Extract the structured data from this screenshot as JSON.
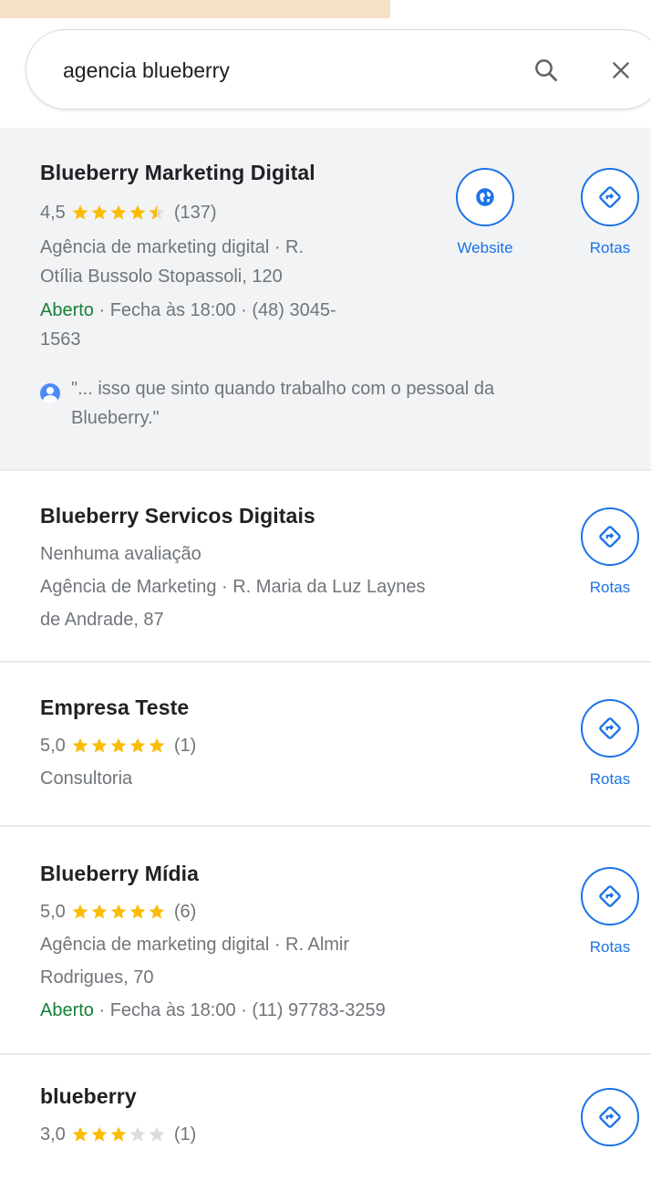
{
  "search": {
    "query": "agencia blueberry",
    "search_icon": "search-icon",
    "clear_icon": "close-icon"
  },
  "colors": {
    "accent": "#1a73e8",
    "star": "#fbbc04",
    "open": "#188038",
    "muted": "#70757a"
  },
  "results": [
    {
      "title": "Blueberry Marketing Digital",
      "rating": "4,5",
      "stars_value": 4.5,
      "reviews": "(137)",
      "category_address_1": "Agência de marketing digital · R.",
      "category_address_2": "Otília Bussolo Stopassoli, 120",
      "open": "Aberto",
      "hours_phone_1": " · Fecha às 18:00 · (48) 3045-",
      "hours_phone_2": "1563",
      "review_1": "\"... isso que sinto quando trabalho com o pessoal da",
      "review_2": "Blueberry.\"",
      "website_label": "Website",
      "website_icon": "globe-icon",
      "directions_label": "Rotas",
      "directions_icon": "directions-icon"
    },
    {
      "title": "Blueberry Servicos Digitais",
      "no_reviews": "Nenhuma avaliação",
      "category_address_1": "Agência de Marketing · R. Maria da Luz Laynes",
      "category_address_2": "de Andrade, 87",
      "directions_label": "Rotas",
      "directions_icon": "directions-icon"
    },
    {
      "title": "Empresa Teste",
      "rating": "5,0",
      "stars_value": 5,
      "reviews": "(1)",
      "category": "Consultoria",
      "directions_label": "Rotas",
      "directions_icon": "directions-icon"
    },
    {
      "title": "Blueberry Mídia",
      "rating": "5,0",
      "stars_value": 5,
      "reviews": "(6)",
      "category_address_1": "Agência de marketing digital · R. Almir",
      "category_address_2": "Rodrigues, 70",
      "open": "Aberto",
      "hours_phone": " · Fecha às 18:00 · (11) 97783-3259",
      "directions_label": "Rotas",
      "directions_icon": "directions-icon"
    },
    {
      "title": "blueberry",
      "rating": "3,0",
      "stars_value": 3,
      "reviews": "(1)",
      "directions_icon": "directions-icon"
    }
  ]
}
